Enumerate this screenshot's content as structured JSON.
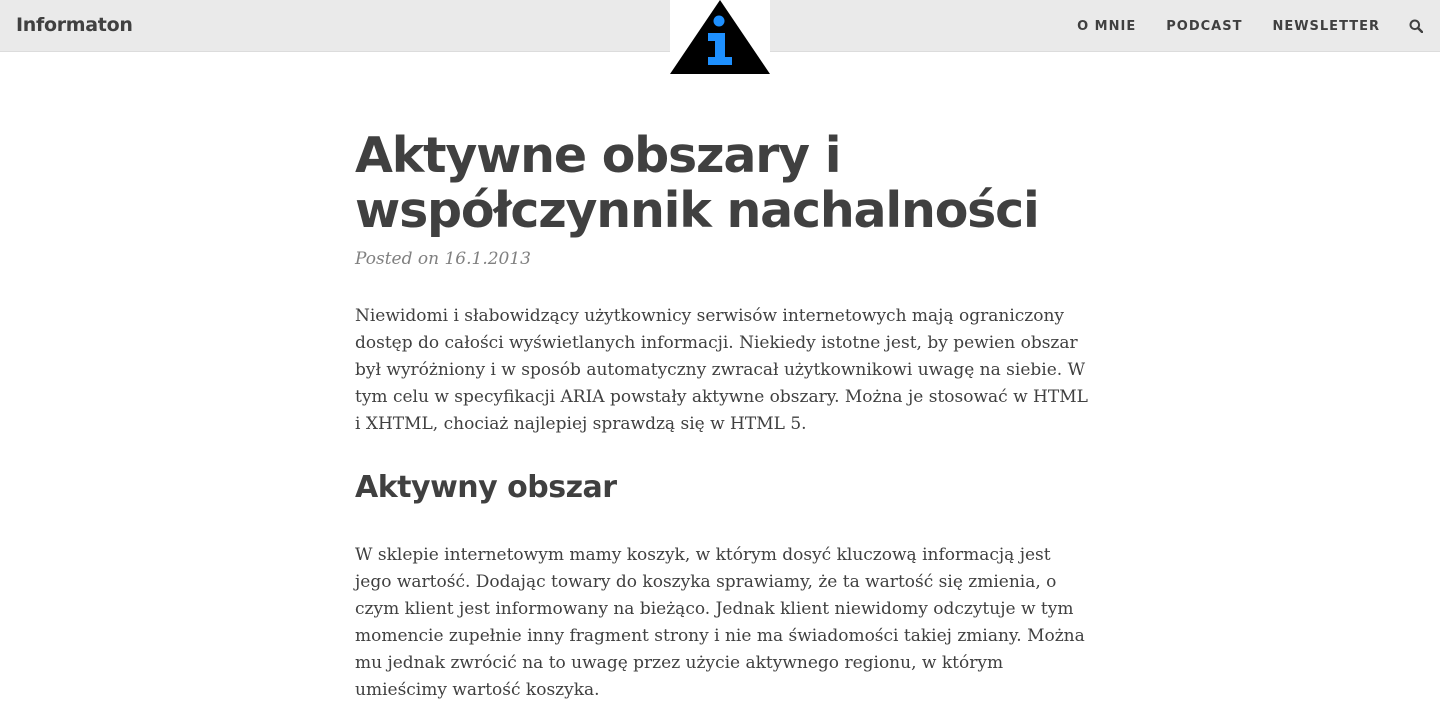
{
  "navbar": {
    "brand": "Informaton",
    "links": [
      "O MNIE",
      "PODCAST",
      "NEWSLETTER"
    ],
    "search_icon": "search-icon",
    "background": "#eaeaea"
  },
  "logo": {
    "icon": "info-triangle-icon",
    "triangle_color": "#000000",
    "glyph_color": "#1e90ff"
  },
  "article": {
    "title": "Aktywne obszary i współczynnik nachalności",
    "meta": "Posted on 16.1.2013",
    "intro": "Niewidomi i słabowidzący użytkownicy serwisów internetowych mają ograniczony dostęp do całości wyświetlanych informacji. Niekiedy istotne jest, by pewien obszar był wyróżniony i w sposób automatyczny zwracał użytkownikowi uwagę na siebie. W tym celu w specyfikacji ARIA powstały aktywne obszary. Można je stosować w HTML i XHTML, chociaż najlepiej sprawdzą się w HTML 5.",
    "section_heading": "Aktywny obszar",
    "section_paragraph": "W sklepie internetowym mamy koszyk, w którym dosyć kluczową informacją jest jego wartość. Dodając towary do koszyka sprawiamy, że ta wartość się zmienia, o czym klient jest informowany na bieżąco. Jednak klient niewidomy odczytuje w tym momencie zupełnie inny fragment strony i nie ma świadomości takiej zmiany. Można mu jednak zwrócić na to uwagę przez użycie aktywnego regionu, w którym umieścimy wartość koszyka."
  }
}
